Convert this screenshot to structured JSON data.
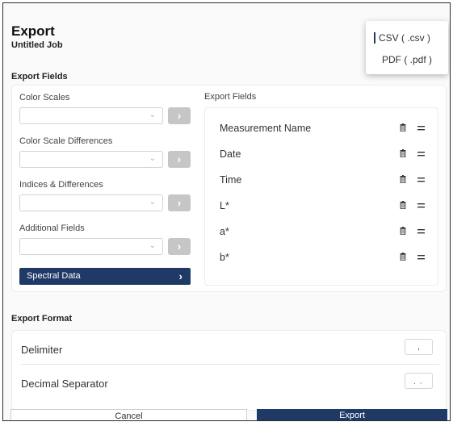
{
  "header": {
    "title": "Export",
    "subtitle": "Untitled Job"
  },
  "export_fields_section": {
    "label": "Export Fields",
    "left_groups": [
      {
        "label": "Color Scales",
        "value": ""
      },
      {
        "label": "Color Scale Differences",
        "value": ""
      },
      {
        "label": "Indices & Differences",
        "value": ""
      },
      {
        "label": "Additional Fields",
        "value": ""
      }
    ],
    "spectral_button": "Spectral Data",
    "selected_title": "Export Fields",
    "selected_items": [
      "Measurement Name",
      "Date",
      "Time",
      "L*",
      "a*",
      "b*"
    ]
  },
  "export_format": {
    "label": "Export Format",
    "delimiter_label": "Delimiter",
    "delimiter_value": ",",
    "decimal_label": "Decimal Separator",
    "decimal_value": "."
  },
  "format_menu": {
    "options": [
      "CSV ( .csv )",
      "PDF ( .pdf )"
    ],
    "selected": "CSV ( .csv )"
  },
  "footer": {
    "cancel_label": "Cancel",
    "export_label": "Export"
  },
  "colors": {
    "accent": "#1f3a66",
    "disabled_button": "#c6c6c6"
  }
}
